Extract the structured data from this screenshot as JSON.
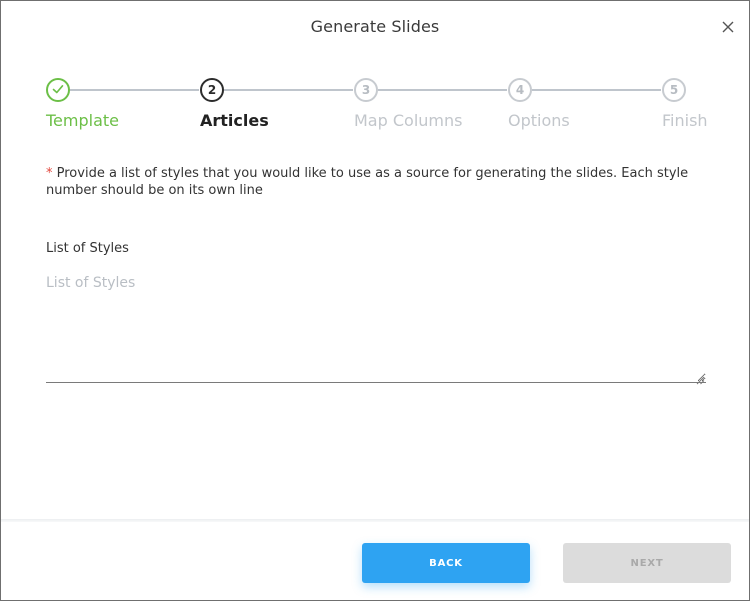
{
  "dialog": {
    "title": "Generate Slides"
  },
  "stepper": {
    "steps": [
      {
        "number": "",
        "label": "Template",
        "state": "done"
      },
      {
        "number": "2",
        "label": "Articles",
        "state": "active"
      },
      {
        "number": "3",
        "label": "Map Columns",
        "state": "pending"
      },
      {
        "number": "4",
        "label": "Options",
        "state": "pending"
      },
      {
        "number": "5",
        "label": "Finish",
        "state": "pending"
      }
    ]
  },
  "form": {
    "required_marker": "*",
    "instructions": "Provide a list of styles that you would like to use as a source for generating the slides. Each style number should be on its own line",
    "styles_label": "List of Styles",
    "styles_placeholder": "List of Styles",
    "styles_value": ""
  },
  "footer": {
    "back_label": "BACK",
    "next_label": "NEXT"
  },
  "colors": {
    "done": "#6cbf47",
    "active": "#2c2c2c",
    "pending": "#c2c6cb",
    "primary_button": "#2ea3f2",
    "disabled_button": "#dcdcdc",
    "required": "#e2463c"
  },
  "icons": {
    "close": "close-icon",
    "done_step": "check-icon",
    "resize": "resize-grip-icon"
  }
}
